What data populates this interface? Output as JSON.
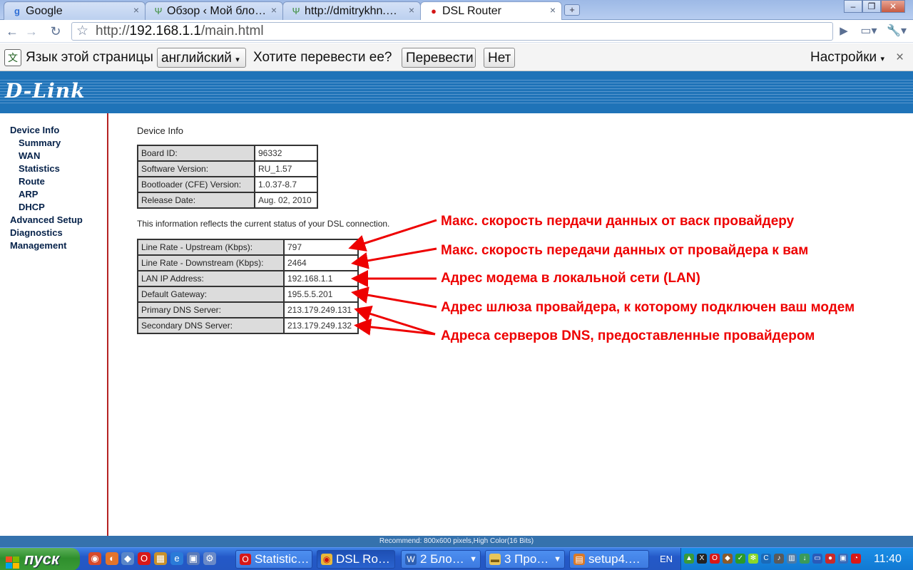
{
  "browser": {
    "tabs": [
      {
        "title": "Google",
        "icon": "google-icon",
        "active": false
      },
      {
        "title": "Обзор ‹ Мой бло…",
        "icon": "wordpress-icon",
        "active": false
      },
      {
        "title": "http://dmitrykhn.…",
        "icon": "wordpress-icon",
        "active": false
      },
      {
        "title": "DSL Router",
        "icon": "dlink-icon",
        "active": true
      }
    ],
    "address": {
      "scheme": "http://",
      "host": "192.168.1.1",
      "path": "/main.html"
    }
  },
  "translate_bar": {
    "prefix": "Язык этой страницы",
    "language": "английский",
    "question": "Хотите перевести ее?",
    "translate_btn": "Перевести",
    "no_btn": "Нет",
    "settings": "Настройки"
  },
  "router": {
    "logo": "D-Link",
    "nav": {
      "device_info": "Device Info",
      "summary": "Summary",
      "wan": "WAN",
      "statistics": "Statistics",
      "route": "Route",
      "arp": "ARP",
      "dhcp": "DHCP",
      "advanced_setup": "Advanced Setup",
      "diagnostics": "Diagnostics",
      "management": "Management"
    },
    "page_title": "Device Info",
    "device_table": [
      {
        "label": "Board ID:",
        "value": "96332"
      },
      {
        "label": "Software Version:",
        "value": "RU_1.57"
      },
      {
        "label": "Bootloader (CFE) Version:",
        "value": "1.0.37-8.7"
      },
      {
        "label": "Release Date:",
        "value": "Aug. 02, 2010"
      }
    ],
    "dsl_note": "This information reflects the current status of your DSL connection.",
    "dsl_table": [
      {
        "label": "Line Rate - Upstream (Kbps):",
        "value": "797"
      },
      {
        "label": "Line Rate - Downstream (Kbps):",
        "value": "2464"
      },
      {
        "label": "LAN IP Address:",
        "value": "192.168.1.1"
      },
      {
        "label": "Default Gateway:",
        "value": "195.5.5.201"
      },
      {
        "label": "Primary DNS Server:",
        "value": "213.179.249.131"
      },
      {
        "label": "Secondary DNS Server:",
        "value": "213.179.249.132"
      }
    ],
    "annotations": {
      "upstream": "Макс. скорость пердачи данных от васк провайдеру",
      "downstream": "Макс. скорость передачи данных от провайдера к вам",
      "lan": "Адрес модема в локальной сети (LAN)",
      "gateway": "Адрес шлюза провайдера, к которому подключен ваш модем",
      "dns": "Адреса серверов DNS, предоставленные провайдером"
    },
    "status_note": "Recommend: 800x600 pixels,High Color(16 Bits)"
  },
  "taskbar": {
    "start": "пуск",
    "tasks": [
      {
        "title": "Statistic…",
        "icon": "opera-icon"
      },
      {
        "title": "DSL Ro…",
        "icon": "chrome-icon"
      },
      {
        "title": "2 Бло…",
        "icon": "word-icon"
      },
      {
        "title": "3 Про…",
        "icon": "folder-icon"
      },
      {
        "title": "setup4.…",
        "icon": "installer-icon"
      }
    ],
    "language": "EN",
    "clock": "11:40"
  },
  "colors": {
    "banner": "#1f73b8",
    "annotation": "#ee0000",
    "nav_text": "#06224a"
  }
}
